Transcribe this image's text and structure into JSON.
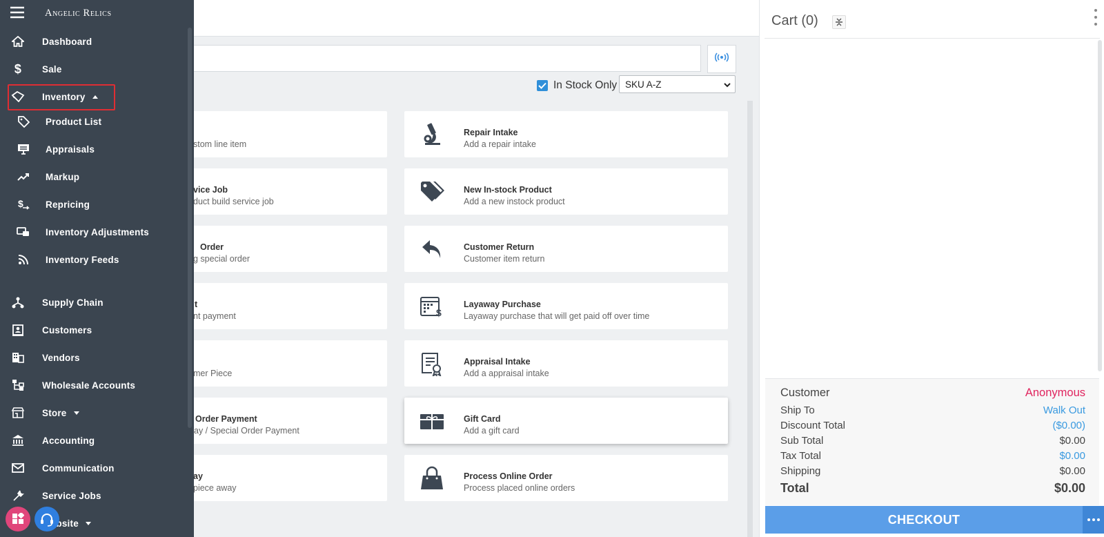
{
  "brand": {
    "name": "Angelic Relics"
  },
  "sidebar": {
    "items": [
      {
        "label": "Dashboard",
        "icon": "home-icon"
      },
      {
        "label": "Sale",
        "icon": "dollar-icon"
      },
      {
        "label": "Inventory",
        "icon": "tags-icon",
        "expanded": true
      },
      {
        "label": "Supply Chain",
        "icon": "network-icon"
      },
      {
        "label": "Customers",
        "icon": "contact-card-icon"
      },
      {
        "label": "Vendors",
        "icon": "building-icon"
      },
      {
        "label": "Wholesale Accounts",
        "icon": "hierarchy-icon"
      },
      {
        "label": "Store",
        "icon": "store-icon"
      },
      {
        "label": "Accounting",
        "icon": "bank-icon"
      },
      {
        "label": "Communication",
        "icon": "envelope-icon"
      },
      {
        "label": "Service Jobs",
        "icon": "tools-icon"
      },
      {
        "label": "Website",
        "icon": "globe-icon"
      }
    ],
    "inventory_sub": [
      {
        "label": "Product List",
        "icon": "tag-icon"
      },
      {
        "label": "Appraisals",
        "icon": "monitor-icon"
      },
      {
        "label": "Markup",
        "icon": "trend-icon"
      },
      {
        "label": "Repricing",
        "icon": "dollar-arrow-icon"
      },
      {
        "label": "Inventory Adjustments",
        "icon": "adjust-icon"
      },
      {
        "label": "Inventory Feeds",
        "icon": "rss-icon"
      }
    ]
  },
  "filters": {
    "in_stock_label": "In Stock Only",
    "in_stock_checked": true,
    "sort_value": "SKU A-Z"
  },
  "tiles_left": [
    {
      "title": "",
      "desc": "stom line item"
    },
    {
      "title": "vice Job",
      "desc": "duct build service job"
    },
    {
      "title": "Order",
      "desc": "g special order"
    },
    {
      "title": "t",
      "desc": "nt payment"
    },
    {
      "title": "",
      "desc": "mer Piece"
    },
    {
      "title": "Order Payment",
      "desc": "ay / Special Order Payment"
    },
    {
      "title": "ay",
      "desc": "piece away"
    }
  ],
  "tiles_right": [
    {
      "title": "Repair Intake",
      "desc": "Add a repair intake",
      "icon": "microscope-icon"
    },
    {
      "title": "New In-stock Product",
      "desc": "Add a new instock product",
      "icon": "tags-icon"
    },
    {
      "title": "Customer Return",
      "desc": "Customer item return",
      "icon": "reply-icon"
    },
    {
      "title": "Layaway Purchase",
      "desc": "Layaway purchase that will get paid off over time",
      "icon": "calendar-dollar-icon"
    },
    {
      "title": "Appraisal Intake",
      "desc": "Add a appraisal intake",
      "icon": "certificate-icon"
    },
    {
      "title": "Gift Card",
      "desc": "Add a gift card",
      "icon": "gift-card-icon"
    },
    {
      "title": "Process Online Order",
      "desc": "Process placed online orders",
      "icon": "shopping-bag-icon"
    }
  ],
  "cart": {
    "title": "Cart (0)",
    "customer_label": "Customer",
    "customer_value": "Anonymous",
    "ship_to_label": "Ship To",
    "ship_to_value": "Walk Out",
    "discount_label": "Discount Total",
    "discount_value": "($0.00)",
    "subtotal_label": "Sub Total",
    "subtotal_value": "$0.00",
    "tax_label": "Tax Total",
    "tax_value": "$0.00",
    "shipping_label": "Shipping",
    "shipping_value": "$0.00",
    "total_label": "Total",
    "total_value": "$0.00",
    "checkout_label": "CHECKOUT"
  },
  "colors": {
    "sidebar": "#3b4550",
    "accent": "#2f8fd9",
    "checkout": "#5b9ee8",
    "highlight": "#e02d33",
    "anonymous": "#e0245e"
  }
}
